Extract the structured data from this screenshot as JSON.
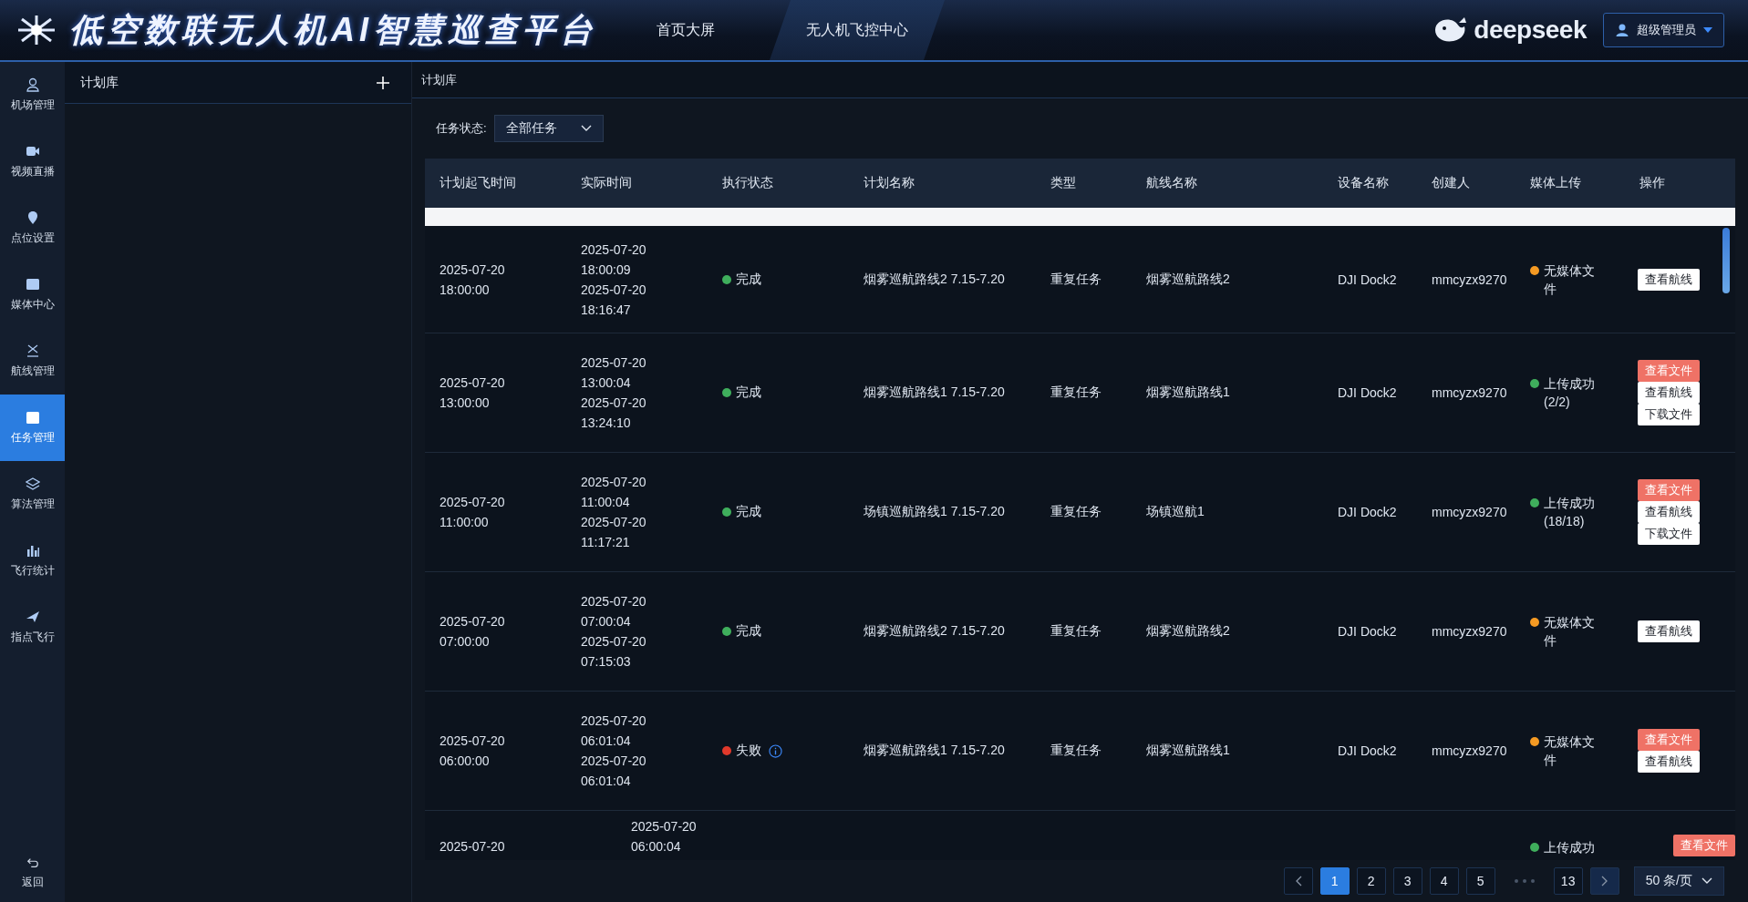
{
  "header": {
    "title": "低空数联无人机AI智慧巡查平台",
    "nav": [
      {
        "label": "首页大屏",
        "selected": false
      },
      {
        "label": "无人机飞控中心",
        "selected": true
      }
    ],
    "brand": "deepseek",
    "user": "超级管理员"
  },
  "sidebar": {
    "items": [
      {
        "label": "机场管理",
        "selected": false
      },
      {
        "label": "视频直播",
        "selected": false
      },
      {
        "label": "点位设置",
        "selected": false
      },
      {
        "label": "媒体中心",
        "selected": false
      },
      {
        "label": "航线管理",
        "selected": false
      },
      {
        "label": "任务管理",
        "selected": true
      },
      {
        "label": "算法管理",
        "selected": false
      },
      {
        "label": "飞行统计",
        "selected": false
      },
      {
        "label": "指点飞行",
        "selected": false
      }
    ],
    "back": "返回"
  },
  "plan_panel": {
    "title": "计划库"
  },
  "breadcrumb": "计划库",
  "filter": {
    "label": "任务状态:",
    "value": "全部任务"
  },
  "table": {
    "columns": [
      "计划起飞时间",
      "实际时间",
      "执行状态",
      "计划名称",
      "类型",
      "航线名称",
      "设备名称",
      "创建人",
      "媒体上传",
      "操作"
    ],
    "rows": [
      {
        "planned": "2025-07-20 18:00:00",
        "actual": [
          "2025-07-20 18:00:09",
          "2025-07-20 18:16:47"
        ],
        "status": {
          "text": "完成",
          "color": "#3fae5c",
          "info": false
        },
        "plan_name": "烟雾巡航路线2 7.15-7.20",
        "type": "重复任务",
        "route": "烟雾巡航路线2",
        "device": "DJI Dock2",
        "creator": "mmcyzx9270",
        "media": {
          "text": "无媒体文件",
          "color": "#f59a23"
        },
        "actions": [
          {
            "label": "查看航线",
            "kind": "plain"
          }
        ]
      },
      {
        "planned": "2025-07-20 13:00:00",
        "actual": [
          "2025-07-20 13:00:04",
          "2025-07-20 13:24:10"
        ],
        "status": {
          "text": "完成",
          "color": "#3fae5c",
          "info": false
        },
        "plan_name": "烟雾巡航路线1 7.15-7.20",
        "type": "重复任务",
        "route": "烟雾巡航路线1",
        "device": "DJI Dock2",
        "creator": "mmcyzx9270",
        "media": {
          "text": "上传成功",
          "count": "(2/2)",
          "color": "#3fae5c"
        },
        "actions": [
          {
            "label": "查看文件",
            "kind": "danger"
          },
          {
            "label": "查看航线",
            "kind": "plain"
          },
          {
            "label": "下载文件",
            "kind": "plain"
          }
        ]
      },
      {
        "planned": "2025-07-20 11:00:00",
        "actual": [
          "2025-07-20 11:00:04",
          "2025-07-20 11:17:21"
        ],
        "status": {
          "text": "完成",
          "color": "#3fae5c",
          "info": false
        },
        "plan_name": "场镇巡航路线1 7.15-7.20",
        "type": "重复任务",
        "route": "场镇巡航1",
        "device": "DJI Dock2",
        "creator": "mmcyzx9270",
        "media": {
          "text": "上传成功",
          "count": "(18/18)",
          "color": "#3fae5c"
        },
        "actions": [
          {
            "label": "查看文件",
            "kind": "danger"
          },
          {
            "label": "查看航线",
            "kind": "plain"
          },
          {
            "label": "下载文件",
            "kind": "plain"
          }
        ]
      },
      {
        "planned": "2025-07-20 07:00:00",
        "actual": [
          "2025-07-20 07:00:04",
          "2025-07-20 07:15:03"
        ],
        "status": {
          "text": "完成",
          "color": "#3fae5c",
          "info": false
        },
        "plan_name": "烟雾巡航路线2 7.15-7.20",
        "type": "重复任务",
        "route": "烟雾巡航路线2",
        "device": "DJI Dock2",
        "creator": "mmcyzx9270",
        "media": {
          "text": "无媒体文件",
          "color": "#f59a23"
        },
        "actions": [
          {
            "label": "查看航线",
            "kind": "plain"
          }
        ]
      },
      {
        "planned": "2025-07-20 06:00:00",
        "actual": [
          "2025-07-20 06:01:04",
          "2025-07-20 06:01:04"
        ],
        "status": {
          "text": "失败",
          "color": "#e0392b",
          "info": true
        },
        "plan_name": "烟雾巡航路线1 7.15-7.20",
        "type": "重复任务",
        "route": "烟雾巡航路线1",
        "device": "DJI Dock2",
        "creator": "mmcyzx9270",
        "media": {
          "text": "无媒体文件",
          "color": "#f59a23"
        },
        "actions": [
          {
            "label": "查看文件",
            "kind": "danger"
          },
          {
            "label": "查看航线",
            "kind": "plain"
          }
        ]
      },
      {
        "cut_off": true,
        "planned": "2025-07-20",
        "actual": [
          "2025-07-20 06:00:04"
        ],
        "media": {
          "text": "上传成功",
          "color": "#3fae5c"
        },
        "actions": [
          {
            "label": "查看文件",
            "kind": "danger"
          }
        ]
      }
    ]
  },
  "pagination": {
    "pages": [
      {
        "label": "1",
        "selected": true
      },
      {
        "label": "2",
        "selected": false
      },
      {
        "label": "3",
        "selected": false
      },
      {
        "label": "4",
        "selected": false
      },
      {
        "label": "5",
        "selected": false
      }
    ],
    "last": "13",
    "page_size": "50 条/页"
  }
}
